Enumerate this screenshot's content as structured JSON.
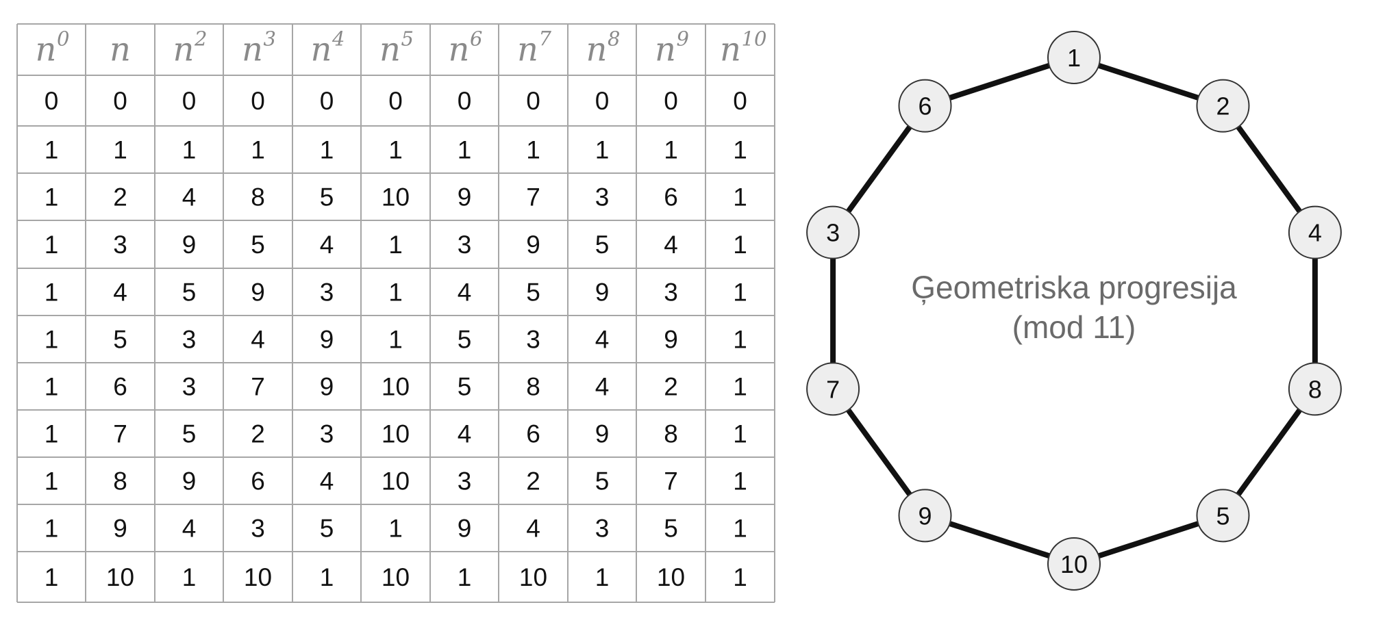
{
  "table": {
    "headers": [
      {
        "base": "n",
        "exp": "0"
      },
      {
        "base": "n",
        "exp": ""
      },
      {
        "base": "n",
        "exp": "2"
      },
      {
        "base": "n",
        "exp": "3"
      },
      {
        "base": "n",
        "exp": "4"
      },
      {
        "base": "n",
        "exp": "5"
      },
      {
        "base": "n",
        "exp": "6"
      },
      {
        "base": "n",
        "exp": "7"
      },
      {
        "base": "n",
        "exp": "8"
      },
      {
        "base": "n",
        "exp": "9"
      },
      {
        "base": "n",
        "exp": "10"
      }
    ],
    "rows": [
      [
        "0",
        "0",
        "0",
        "0",
        "0",
        "0",
        "0",
        "0",
        "0",
        "0",
        "0"
      ],
      [
        "1",
        "1",
        "1",
        "1",
        "1",
        "1",
        "1",
        "1",
        "1",
        "1",
        "1"
      ],
      [
        "1",
        "2",
        "4",
        "8",
        "5",
        "10",
        "9",
        "7",
        "3",
        "6",
        "1"
      ],
      [
        "1",
        "3",
        "9",
        "5",
        "4",
        "1",
        "3",
        "9",
        "5",
        "4",
        "1"
      ],
      [
        "1",
        "4",
        "5",
        "9",
        "3",
        "1",
        "4",
        "5",
        "9",
        "3",
        "1"
      ],
      [
        "1",
        "5",
        "3",
        "4",
        "9",
        "1",
        "5",
        "3",
        "4",
        "9",
        "1"
      ],
      [
        "1",
        "6",
        "3",
        "7",
        "9",
        "10",
        "5",
        "8",
        "4",
        "2",
        "1"
      ],
      [
        "1",
        "7",
        "5",
        "2",
        "3",
        "10",
        "4",
        "6",
        "9",
        "8",
        "1"
      ],
      [
        "1",
        "8",
        "9",
        "6",
        "4",
        "10",
        "3",
        "2",
        "5",
        "7",
        "1"
      ],
      [
        "1",
        "9",
        "4",
        "3",
        "5",
        "1",
        "9",
        "4",
        "3",
        "5",
        "1"
      ],
      [
        "1",
        "10",
        "1",
        "10",
        "1",
        "10",
        "1",
        "10",
        "1",
        "10",
        "1"
      ]
    ],
    "border_color": "#a6a6a6"
  },
  "diagram": {
    "caption_line1": "Ģeometriska progresija",
    "caption_line2": "(mod 11)",
    "cycle_order": [
      "1",
      "2",
      "4",
      "8",
      "5",
      "10",
      "9",
      "7",
      "3",
      "6"
    ],
    "node_fill": "#eeeeee",
    "node_stroke": "#333333",
    "edge_color": "#111111"
  }
}
